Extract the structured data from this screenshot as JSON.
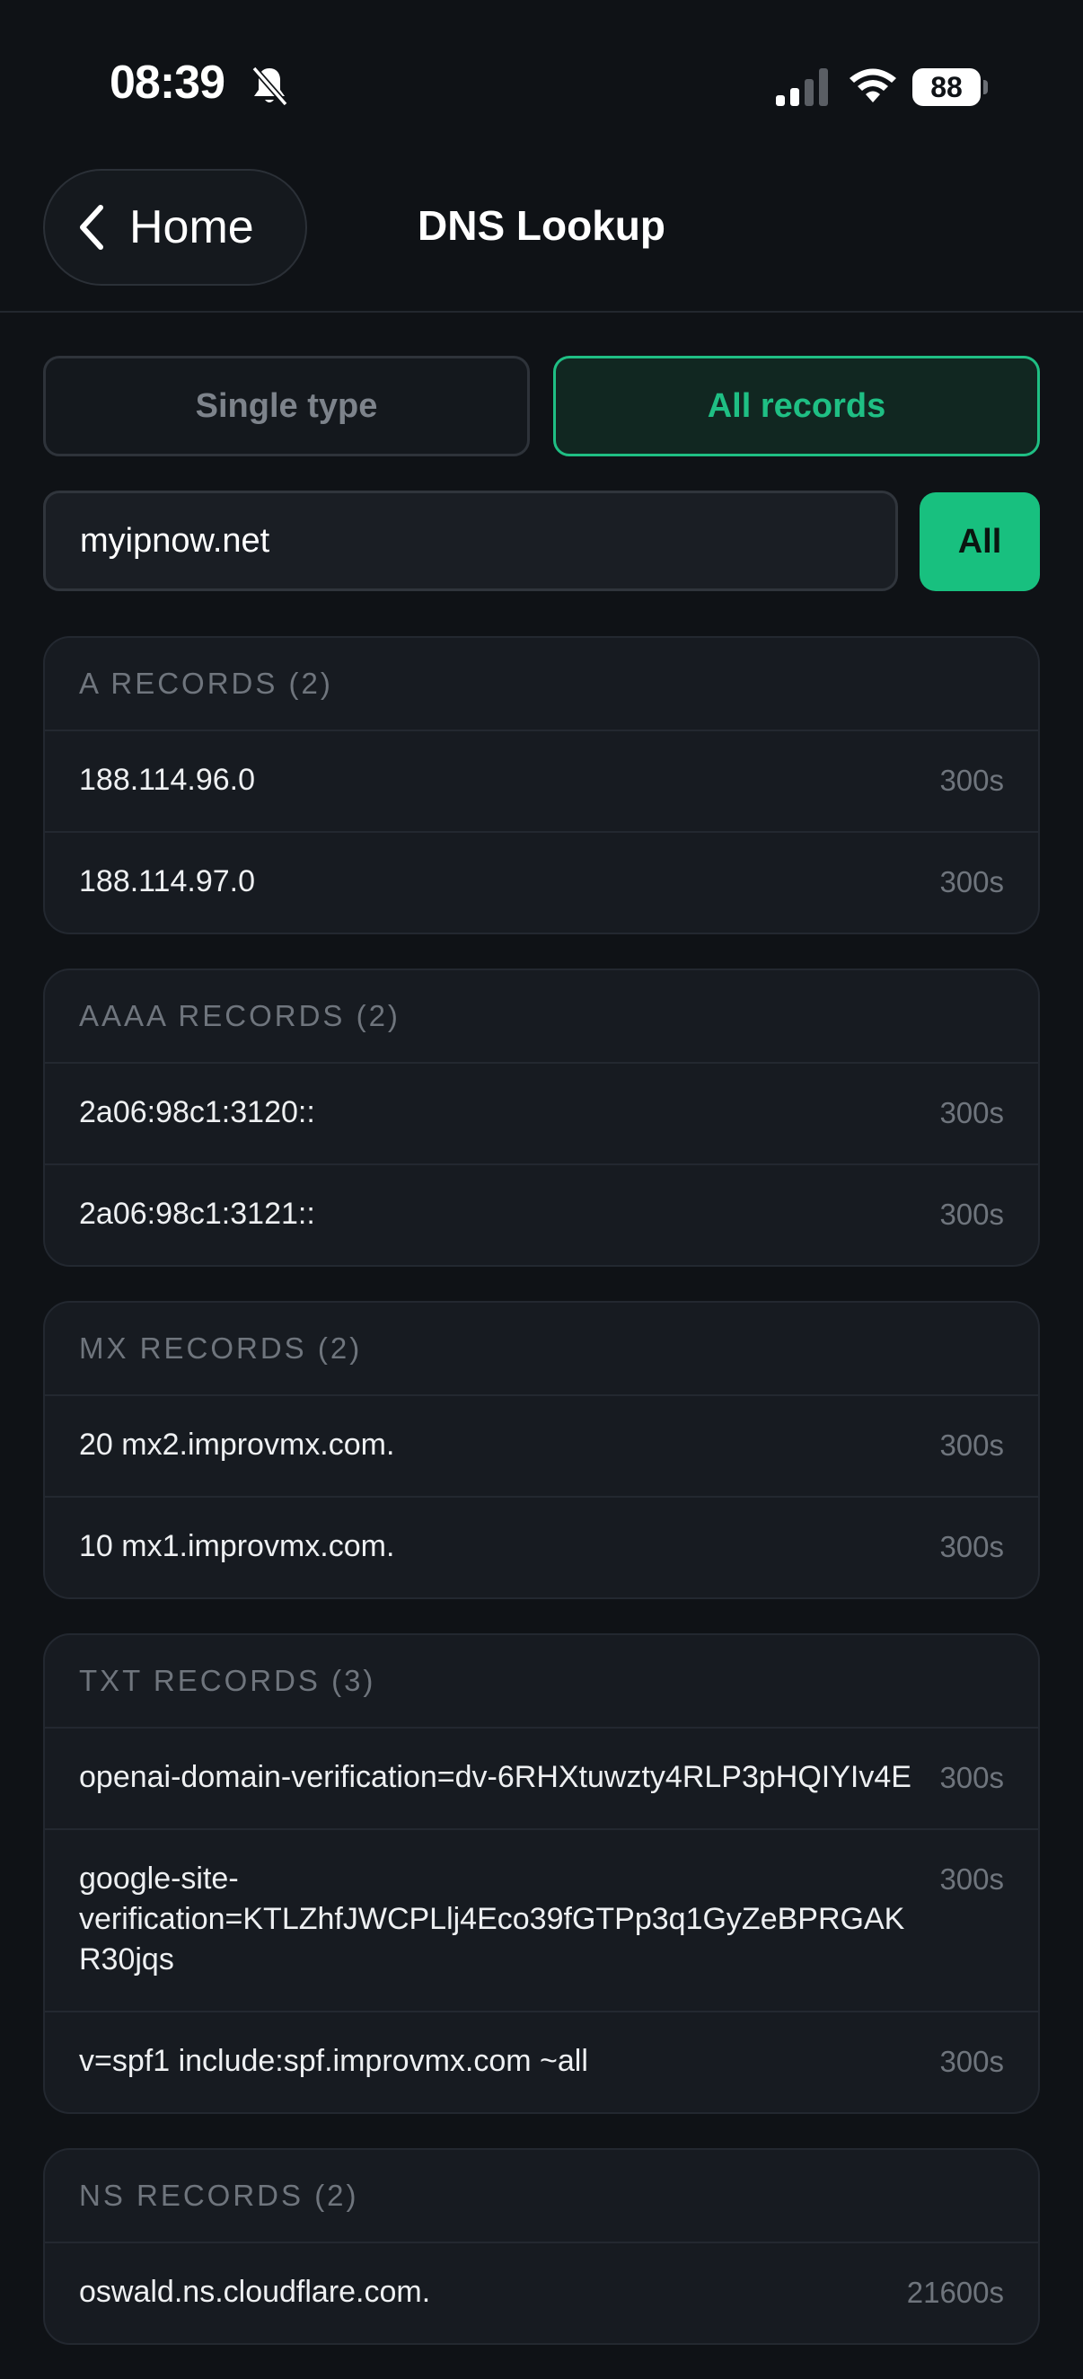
{
  "status": {
    "time": "08:39",
    "battery": "88"
  },
  "nav": {
    "back_label": "Home",
    "title": "DNS Lookup"
  },
  "mode": {
    "single_label": "Single type",
    "all_label": "All records",
    "selected": "All records"
  },
  "search": {
    "domain": "myipnow.net",
    "type_button": "All"
  },
  "sections": [
    {
      "header": "A RECORDS (2)",
      "records": [
        {
          "value": "188.114.96.0",
          "ttl": "300s"
        },
        {
          "value": "188.114.97.0",
          "ttl": "300s"
        }
      ]
    },
    {
      "header": "AAAA RECORDS (2)",
      "records": [
        {
          "value": "2a06:98c1:3120::",
          "ttl": "300s"
        },
        {
          "value": "2a06:98c1:3121::",
          "ttl": "300s"
        }
      ]
    },
    {
      "header": "MX RECORDS (2)",
      "records": [
        {
          "value": "20 mx2.improvmx.com.",
          "ttl": "300s"
        },
        {
          "value": "10 mx1.improvmx.com.",
          "ttl": "300s"
        }
      ]
    },
    {
      "header": "TXT RECORDS (3)",
      "records": [
        {
          "value": "openai-domain-verification=dv-6RHXtuwzty4RLP3pHQIYIv4E",
          "ttl": "300s"
        },
        {
          "value": "google-site-verification=KTLZhfJWCPLlj4Eco39fGTPp3q1GyZeBPRGAKR30jqs",
          "ttl": "300s"
        },
        {
          "value": "v=spf1 include:spf.improvmx.com ~all",
          "ttl": "300s"
        }
      ]
    },
    {
      "header": "NS RECORDS (2)",
      "records": [
        {
          "value": "oswald.ns.cloudflare.com.",
          "ttl": "21600s"
        }
      ]
    }
  ],
  "colors": {
    "background": "#0f1216",
    "accent": "#1fbf84",
    "card": "#171b21"
  }
}
